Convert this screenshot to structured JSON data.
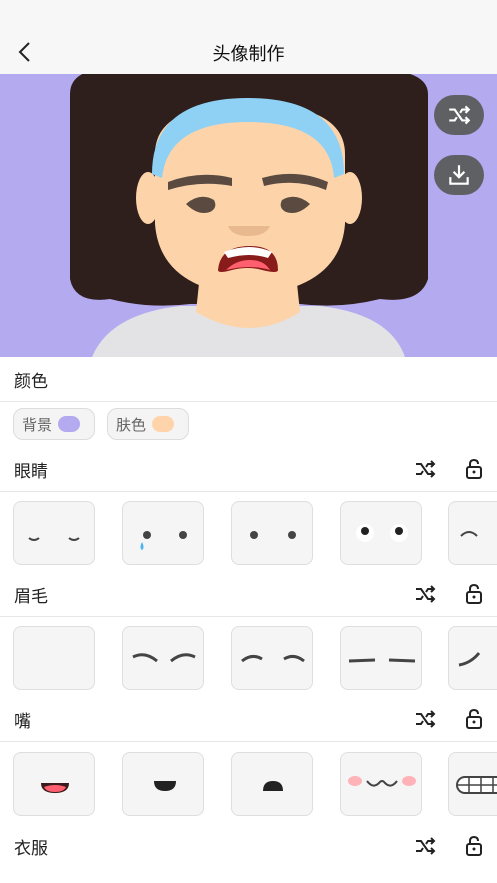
{
  "header": {
    "title": "头像制作"
  },
  "colors": {
    "background_swatch": "#b3aaf0",
    "skin_swatch": "#ffd4ab",
    "preview_bg": "#b3aaf0"
  },
  "sections": {
    "color": {
      "title": "颜色",
      "chips": [
        "背景",
        "肤色"
      ]
    },
    "eyes": {
      "title": "眼睛"
    },
    "brows": {
      "title": "眉毛"
    },
    "mouth": {
      "title": "嘴"
    },
    "clothes": {
      "title": "衣服"
    }
  },
  "icons": {
    "back": "chevron-left-icon",
    "shuffle": "shuffle-icon",
    "download": "download-icon",
    "lock": "lock-icon"
  }
}
